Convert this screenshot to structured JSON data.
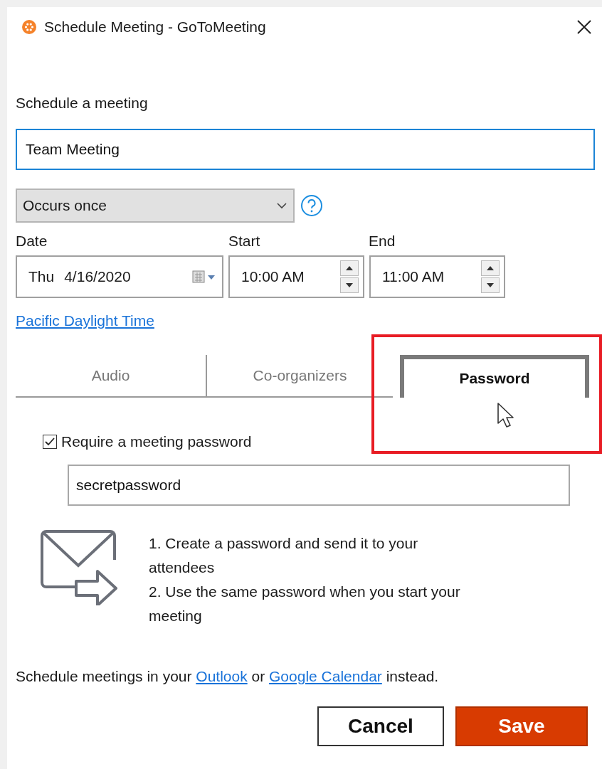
{
  "window": {
    "title": "Schedule Meeting - GoToMeeting"
  },
  "heading": "Schedule a meeting",
  "meeting_name": {
    "value": "Team Meeting"
  },
  "recurrence": {
    "value": "Occurs once"
  },
  "date": {
    "label": "Date",
    "day": "Thu",
    "value": "4/16/2020"
  },
  "start": {
    "label": "Start",
    "value": "10:00 AM"
  },
  "end": {
    "label": "End",
    "value": "11:00 AM"
  },
  "timezone_link": "Pacific Daylight Time",
  "tabs": [
    {
      "label": "Audio",
      "selected": false
    },
    {
      "label": "Co-organizers",
      "selected": false
    },
    {
      "label": "Password",
      "selected": true
    }
  ],
  "require_password": {
    "label": "Require a meeting password",
    "checked": true
  },
  "password": {
    "value": "secretpassword"
  },
  "instructions": [
    {
      "lines": [
        "1. Create a password and send it to your",
        "attendees"
      ]
    },
    {
      "lines": [
        "2. Use the same password when you start your",
        "meeting"
      ]
    }
  ],
  "footer": [
    {
      "kind": "text",
      "text": "Schedule meetings in your "
    },
    {
      "kind": "link",
      "text": "Outlook"
    },
    {
      "kind": "text",
      "text": " or "
    },
    {
      "kind": "link",
      "text": "Google Calendar"
    },
    {
      "kind": "text",
      "text": " instead."
    }
  ],
  "buttons": [
    {
      "label": "Cancel",
      "kind": "secondary"
    },
    {
      "label": "Save",
      "kind": "primary"
    }
  ]
}
